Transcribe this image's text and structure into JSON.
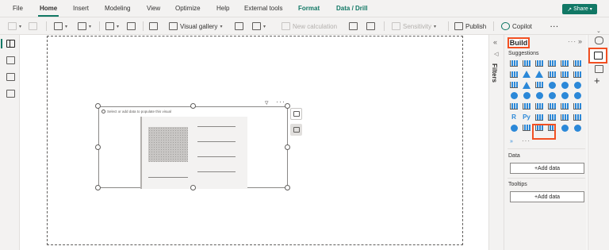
{
  "menu": {
    "items": [
      "File",
      "Home",
      "Insert",
      "Modeling",
      "View",
      "Optimize",
      "Help",
      "External tools",
      "Format",
      "Data / Drill"
    ],
    "active": "Home",
    "share_label": "Share"
  },
  "ribbon": {
    "visual_gallery": "Visual gallery",
    "new_calculation": "New calculation",
    "sensitivity": "Sensitivity",
    "publish": "Publish",
    "copilot": "Copilot",
    "more": "···"
  },
  "canvas": {
    "visual_hint": "Select or add data to populate this visual"
  },
  "filters": {
    "label": "Filters"
  },
  "build": {
    "title": "Build",
    "more": "···",
    "suggestions_label": "Suggestions",
    "visual_icons": [
      "stacked-bar-chart-icon",
      "stacked-column-chart-icon",
      "clustered-bar-chart-icon",
      "clustered-column-chart-icon",
      "100-percent-bar-chart-icon",
      "100-percent-column-chart-icon",
      "line-chart-icon",
      "area-chart-icon",
      "stacked-area-chart-icon",
      "line-column-chart-icon",
      "line-stacked-column-chart-icon",
      "ribbon-chart-icon",
      "waterfall-chart-icon",
      "funnel-chart-icon",
      "scatter-chart-icon",
      "pie-chart-icon",
      "donut-chart-icon",
      "treemap-icon",
      "map-icon",
      "filled-map-icon",
      "shape-map-icon",
      "azure-map-icon",
      "arcgis-map-icon",
      "gauge-icon",
      "card-icon",
      "multi-row-card-icon",
      "kpi-icon",
      "slicer-icon",
      "table-icon",
      "matrix-icon",
      "r-visual-icon",
      "python-visual-icon",
      "key-influencers-icon",
      "decomposition-tree-icon",
      "qna-icon",
      "smart-narrative-icon",
      "trophy-icon",
      "paginated-report-icon",
      "new-card-icon",
      "new-slicer-icon",
      "power-apps-icon",
      "power-automate-icon"
    ],
    "r_label": "R",
    "py_label": "Py",
    "more_visuals": "»",
    "data_label": "Data",
    "add_data_label": "+Add data",
    "tooltips_label": "Tooltips",
    "add_tooltip_label": "+Add data"
  },
  "colors": {
    "accent": "#117865",
    "highlight": "#f25022",
    "visual_blue": "#2b88d8"
  }
}
